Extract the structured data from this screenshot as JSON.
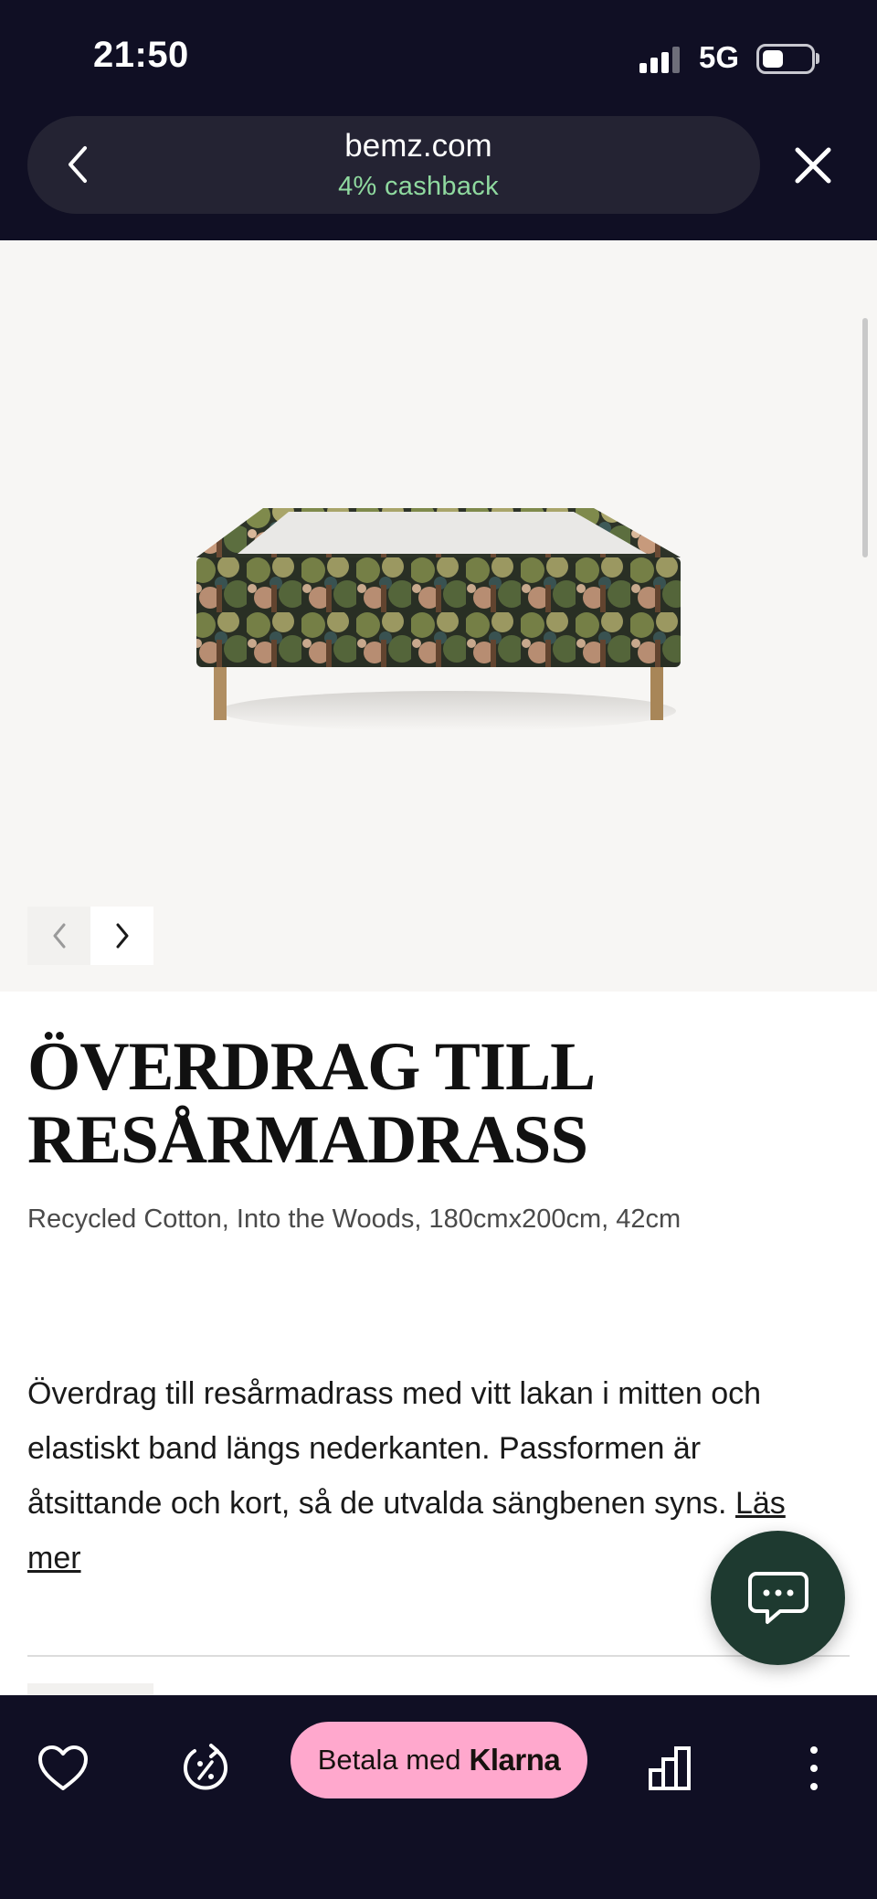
{
  "status_bar": {
    "time": "21:50",
    "network": "5G",
    "icons": [
      "signal-icon",
      "battery-icon"
    ]
  },
  "browser": {
    "domain": "bemz.com",
    "cashback": "4% cashback",
    "icons": [
      "back-chevron-icon",
      "close-icon"
    ]
  },
  "product": {
    "title_line1": "ÖVERDRAG TILL",
    "title_line2": "RESÅRMADRASS",
    "subtitle": "Recycled Cotton, Into the Woods, 180cmx200cm, 42cm",
    "description": "Överdrag till resårmadrass med vitt lakan i mitten och elastiskt band längs nederkanten. Passformen är åtsittande och kort, så de utvalda sängbenen syns.",
    "read_more": "Läs mer"
  },
  "gallery": {
    "icons": [
      "chevron-left-icon",
      "chevron-right-icon"
    ]
  },
  "chat": {
    "icon": "chat-bubble-icon"
  },
  "toolbar": {
    "klarna_prefix": "Betala med",
    "klarna_brand": "Klarna",
    "icons": [
      "heart-icon",
      "cashback-timer-icon",
      "bar-chart-icon",
      "more-vertical-icon"
    ]
  }
}
